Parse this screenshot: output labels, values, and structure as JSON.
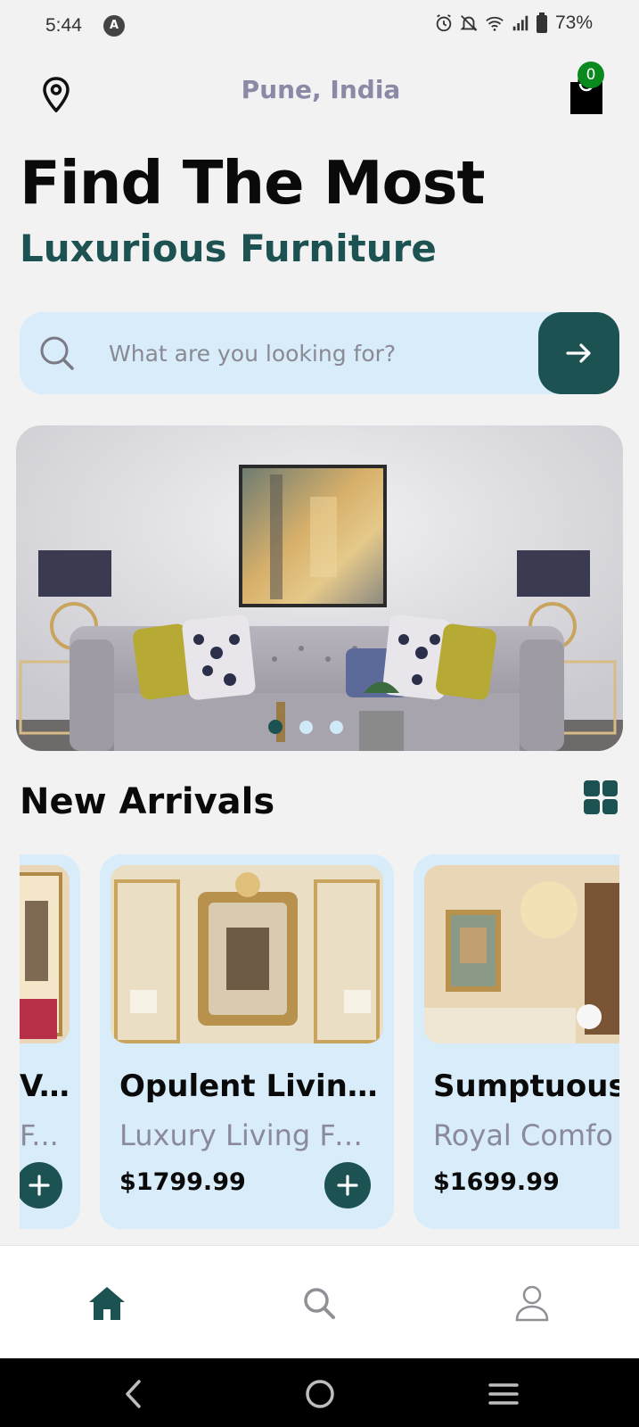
{
  "status_bar": {
    "time": "5:44",
    "app_icon": "A",
    "battery": "73%",
    "icons": [
      "alarm-icon",
      "bell-off-icon",
      "wifi-icon",
      "signal-icon",
      "battery-icon"
    ]
  },
  "header": {
    "location": "Pune, India",
    "location_icon": "map-pin-icon",
    "cart_icon": "shopping-bag-icon",
    "cart_count": "0"
  },
  "hero": {
    "headline": "Find The Most",
    "subheadline": "Luxurious Furniture"
  },
  "search": {
    "placeholder": "What are you looking for?",
    "value": "",
    "search_icon": "search-icon",
    "submit_icon": "arrow-right-icon"
  },
  "banner": {
    "image": "living-room-sofa-photo",
    "slide_count": 3,
    "active_slide": 1
  },
  "new_arrivals": {
    "title": "New Arrivals",
    "layout_icon": "grid-view-icon",
    "products": [
      {
        "title": "V...",
        "subtitle": "F...",
        "price": "",
        "image": "gilded-room-photo"
      },
      {
        "title": "Opulent Livin...",
        "subtitle": "Luxury Living Fur...",
        "price": "$1799.99",
        "image": "gold-mirror-panel-room-photo"
      },
      {
        "title": "Sumptuous",
        "subtitle": "Royal Comfo",
        "price": "$1699.99",
        "image": "chandelier-salon-photo"
      }
    ]
  },
  "bottom_nav": {
    "items": [
      {
        "name": "home",
        "icon": "home-icon",
        "active": true
      },
      {
        "name": "search",
        "icon": "search-icon",
        "active": false
      },
      {
        "name": "profile",
        "icon": "user-icon",
        "active": false
      }
    ]
  },
  "system_nav": {
    "items": [
      "back-icon",
      "home-circle-icon",
      "recents-icon"
    ]
  },
  "colors": {
    "accent": "#1d5252",
    "card_bg": "#d8ecf9",
    "location_text": "#8a8aa6",
    "badge": "#0a8a1e",
    "page_bg": "#f2f2f2"
  }
}
